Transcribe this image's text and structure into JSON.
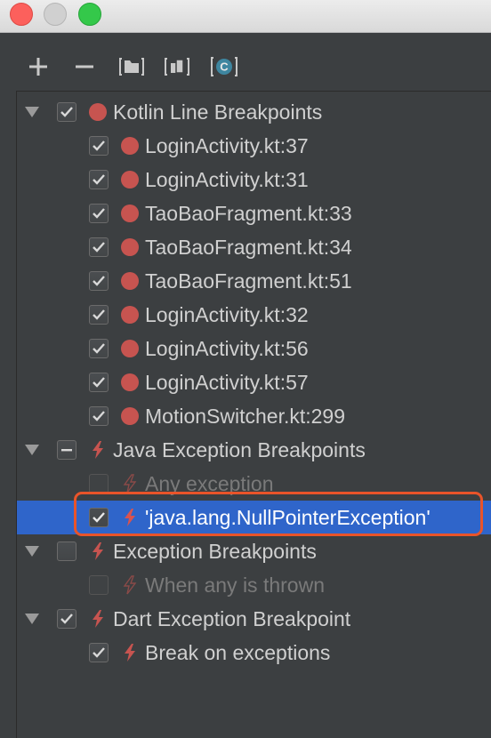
{
  "window": {
    "traffic_lights": [
      "close",
      "minimize",
      "maximize"
    ]
  },
  "toolbar": {
    "buttons": [
      {
        "name": "add-breakpoint-button",
        "icon": "plus-icon"
      },
      {
        "name": "remove-breakpoint-button",
        "icon": "minus-icon"
      },
      {
        "name": "group-by-file-button",
        "icon": "folder-group-icon"
      },
      {
        "name": "group-by-package-button",
        "icon": "package-group-icon"
      },
      {
        "name": "group-by-class-button",
        "icon": "class-c-icon"
      }
    ]
  },
  "tree": {
    "groups": [
      {
        "label": "Kotlin Line Breakpoints",
        "checked": "checked",
        "icon": "red-dot-icon",
        "items": [
          {
            "label": "LoginActivity.kt:37",
            "checked": true
          },
          {
            "label": "LoginActivity.kt:31",
            "checked": true
          },
          {
            "label": "TaoBaoFragment.kt:33",
            "checked": true
          },
          {
            "label": "TaoBaoFragment.kt:34",
            "checked": true
          },
          {
            "label": "TaoBaoFragment.kt:51",
            "checked": true
          },
          {
            "label": "LoginActivity.kt:32",
            "checked": true
          },
          {
            "label": "LoginActivity.kt:56",
            "checked": true
          },
          {
            "label": "LoginActivity.kt:57",
            "checked": true
          },
          {
            "label": "MotionSwitcher.kt:299",
            "checked": true
          }
        ]
      },
      {
        "label": "Java Exception Breakpoints",
        "checked": "partial",
        "icon": "lightning-icon",
        "items": [
          {
            "label": "Any exception",
            "checked": false,
            "dim": true
          },
          {
            "label": "'java.lang.NullPointerException'",
            "checked": true,
            "selected": true
          }
        ]
      },
      {
        "label": "Exception Breakpoints",
        "checked": "unchecked",
        "icon": "lightning-icon",
        "items": [
          {
            "label": "When any is thrown",
            "checked": false,
            "dim": true
          }
        ]
      },
      {
        "label": "Dart Exception Breakpoint",
        "checked": "checked",
        "icon": "lightning-icon",
        "items": [
          {
            "label": "Break on exceptions",
            "checked": true
          }
        ]
      }
    ]
  },
  "colors": {
    "panel_bg": "#3c3f41",
    "selection": "#2f65ca",
    "breakpoint_red": "#c75450",
    "highlight_border": "#e9542a"
  }
}
